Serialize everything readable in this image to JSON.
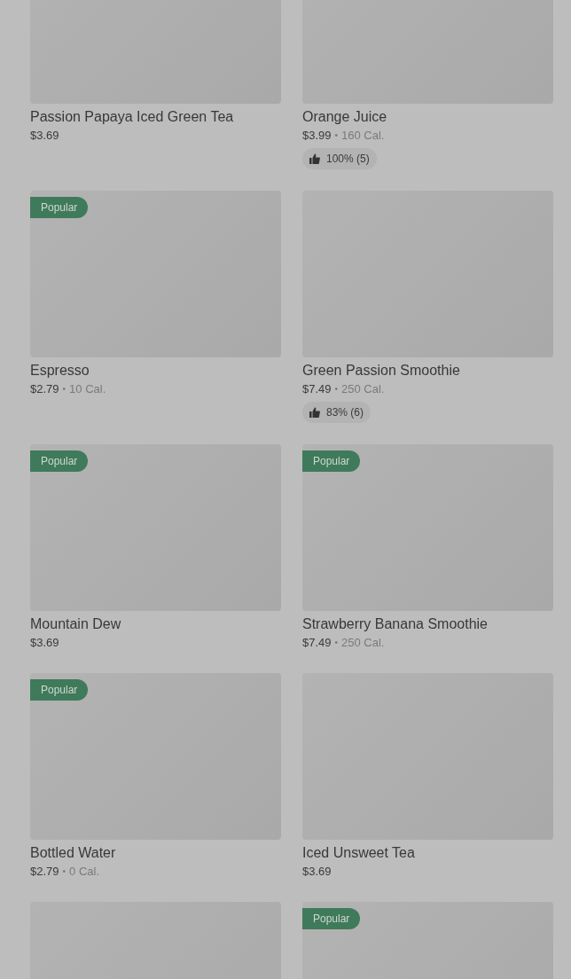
{
  "items": [
    {
      "kind": "product",
      "name": "Passion Papaya Iced Green Tea",
      "price": "$3.69"
    },
    {
      "kind": "product",
      "name": "Orange Juice",
      "price": "$3.99",
      "separator": "•",
      "calories": "160 Cal.",
      "rating": "100% (5)"
    },
    {
      "kind": "product",
      "badge": "Popular",
      "name": "Espresso",
      "price": "$2.79",
      "separator": "•",
      "calories": "10 Cal."
    },
    {
      "kind": "product",
      "name": "Green Passion Smoothie",
      "price": "$7.49",
      "separator": "•",
      "calories": "250 Cal.",
      "rating": "83% (6)"
    },
    {
      "kind": "product",
      "badge": "Popular",
      "name": "Mountain Dew",
      "price": "$3.69"
    },
    {
      "kind": "product",
      "badge": "Popular",
      "name": "Strawberry Banana Smoothie",
      "price": "$7.49",
      "separator": "•",
      "calories": "250 Cal."
    },
    {
      "kind": "product",
      "badge": "Popular",
      "name": "Bottled Water",
      "price": "$2.79",
      "separator": "•",
      "calories": "0 Cal."
    },
    {
      "kind": "product",
      "name": "Iced Unsweet Tea",
      "price": "$3.69"
    },
    {
      "kind": "picture"
    },
    {
      "kind": "picture",
      "badge": "Popular"
    }
  ]
}
